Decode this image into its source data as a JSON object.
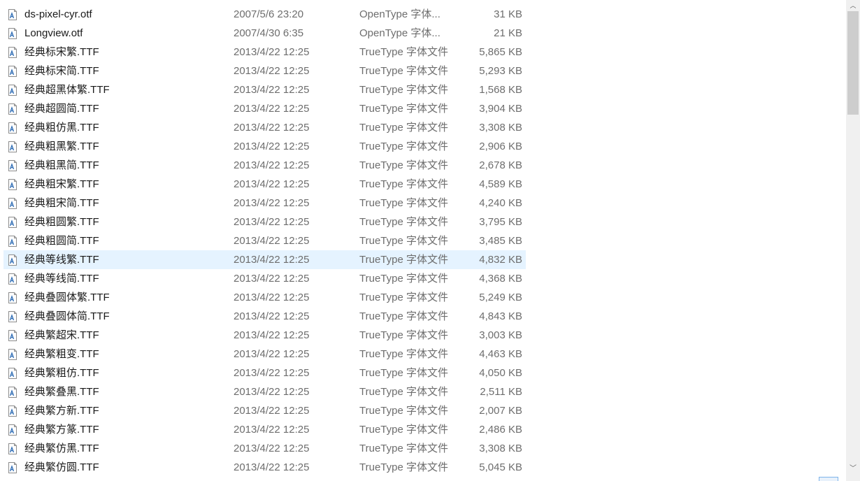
{
  "icons": {
    "file": "font-file-icon",
    "scroll_up": "chevron-up-icon",
    "scroll_down": "chevron-down-icon"
  },
  "scrollbar": {
    "up_glyph": "︿",
    "down_glyph": "﹀"
  },
  "files": [
    {
      "name": "ds-pixel-cyr.otf",
      "date": "2007/5/6 23:20",
      "type": "OpenType 字体...",
      "size": "31 KB"
    },
    {
      "name": "Longview.otf",
      "date": "2007/4/30 6:35",
      "type": "OpenType 字体...",
      "size": "21 KB"
    },
    {
      "name": "经典标宋繁.TTF",
      "date": "2013/4/22 12:25",
      "type": "TrueType 字体文件",
      "size": "5,865 KB"
    },
    {
      "name": "经典标宋简.TTF",
      "date": "2013/4/22 12:25",
      "type": "TrueType 字体文件",
      "size": "5,293 KB"
    },
    {
      "name": "经典超黑体繁.TTF",
      "date": "2013/4/22 12:25",
      "type": "TrueType 字体文件",
      "size": "1,568 KB"
    },
    {
      "name": "经典超圆简.TTF",
      "date": "2013/4/22 12:25",
      "type": "TrueType 字体文件",
      "size": "3,904 KB"
    },
    {
      "name": "经典粗仿黑.TTF",
      "date": "2013/4/22 12:25",
      "type": "TrueType 字体文件",
      "size": "3,308 KB"
    },
    {
      "name": "经典粗黑繁.TTF",
      "date": "2013/4/22 12:25",
      "type": "TrueType 字体文件",
      "size": "2,906 KB"
    },
    {
      "name": "经典粗黑简.TTF",
      "date": "2013/4/22 12:25",
      "type": "TrueType 字体文件",
      "size": "2,678 KB"
    },
    {
      "name": "经典粗宋繁.TTF",
      "date": "2013/4/22 12:25",
      "type": "TrueType 字体文件",
      "size": "4,589 KB"
    },
    {
      "name": "经典粗宋简.TTF",
      "date": "2013/4/22 12:25",
      "type": "TrueType 字体文件",
      "size": "4,240 KB"
    },
    {
      "name": "经典粗圆繁.TTF",
      "date": "2013/4/22 12:25",
      "type": "TrueType 字体文件",
      "size": "3,795 KB"
    },
    {
      "name": "经典粗圆简.TTF",
      "date": "2013/4/22 12:25",
      "type": "TrueType 字体文件",
      "size": "3,485 KB"
    },
    {
      "name": "经典等线繁.TTF",
      "date": "2013/4/22 12:25",
      "type": "TrueType 字体文件",
      "size": "4,832 KB",
      "selected": true
    },
    {
      "name": "经典等线简.TTF",
      "date": "2013/4/22 12:25",
      "type": "TrueType 字体文件",
      "size": "4,368 KB"
    },
    {
      "name": "经典叠圆体繁.TTF",
      "date": "2013/4/22 12:25",
      "type": "TrueType 字体文件",
      "size": "5,249 KB"
    },
    {
      "name": "经典叠圆体简.TTF",
      "date": "2013/4/22 12:25",
      "type": "TrueType 字体文件",
      "size": "4,843 KB"
    },
    {
      "name": "经典繁超宋.TTF",
      "date": "2013/4/22 12:25",
      "type": "TrueType 字体文件",
      "size": "3,003 KB"
    },
    {
      "name": "经典繁粗变.TTF",
      "date": "2013/4/22 12:25",
      "type": "TrueType 字体文件",
      "size": "4,463 KB"
    },
    {
      "name": "经典繁粗仿.TTF",
      "date": "2013/4/22 12:25",
      "type": "TrueType 字体文件",
      "size": "4,050 KB"
    },
    {
      "name": "经典繁叠黑.TTF",
      "date": "2013/4/22 12:25",
      "type": "TrueType 字体文件",
      "size": "2,511 KB"
    },
    {
      "name": "经典繁方新.TTF",
      "date": "2013/4/22 12:25",
      "type": "TrueType 字体文件",
      "size": "2,007 KB"
    },
    {
      "name": "经典繁方篆.TTF",
      "date": "2013/4/22 12:25",
      "type": "TrueType 字体文件",
      "size": "2,486 KB"
    },
    {
      "name": "经典繁仿黑.TTF",
      "date": "2013/4/22 12:25",
      "type": "TrueType 字体文件",
      "size": "3,308 KB"
    },
    {
      "name": "经典繁仿圆.TTF",
      "date": "2013/4/22 12:25",
      "type": "TrueType 字体文件",
      "size": "5,045 KB"
    }
  ]
}
